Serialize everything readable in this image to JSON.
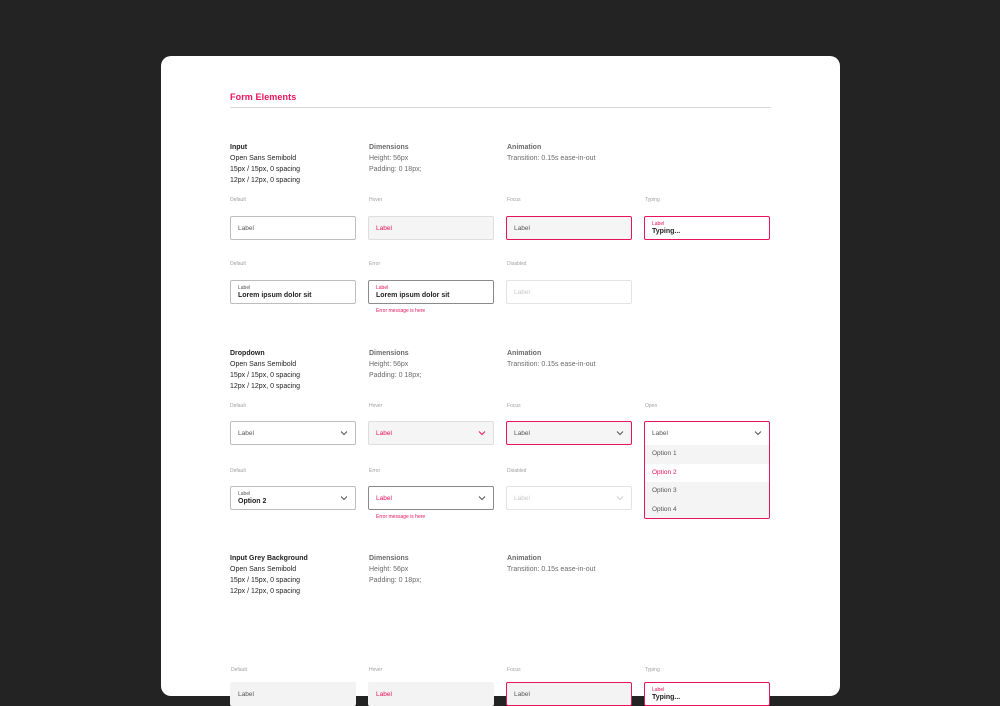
{
  "page_title": "Form Elements",
  "colors": {
    "accent": "#e8135b",
    "background": "#232323",
    "sheet": "#ffffff"
  },
  "sections": {
    "input": {
      "spec": {
        "name": "Input",
        "font": "Open Sans Semibold",
        "size_1": "15px / 15px, 0 spacing",
        "size_2": "12px / 12px, 0 spacing",
        "dim_title": "Dimensions",
        "height": "Height: 56px",
        "padding": "Padding: 0 18px;",
        "anim_title": "Animation",
        "transition": "Transition: 0.15s ease-in-out"
      },
      "row1": {
        "default": {
          "state": "Default",
          "placeholder": "Label"
        },
        "hover": {
          "state": "Hover",
          "placeholder": "Label"
        },
        "focus": {
          "state": "Focus",
          "placeholder": "Label"
        },
        "typing": {
          "state": "Typing",
          "label": "Label",
          "value": "Typing..."
        }
      },
      "row2": {
        "default": {
          "state": "Default",
          "label": "Label",
          "value": "Lorem ipsum dolor sit"
        },
        "error": {
          "state": "Error",
          "label": "Label",
          "value": "Lorem ipsum dolor sit",
          "message": "Error message is here"
        },
        "disabled": {
          "state": "Disabled",
          "placeholder": "Label"
        }
      }
    },
    "dropdown": {
      "spec": {
        "name": "Dropdown",
        "font": "Open Sans Semibold",
        "size_1": "15px / 15px, 0 spacing",
        "size_2": "12px / 12px, 0 spacing",
        "dim_title": "Dimensions",
        "height": "Height: 56px",
        "padding": "Padding: 0 18px;",
        "anim_title": "Animation",
        "transition": "Transition: 0.15s ease-in-out"
      },
      "row1": {
        "default": {
          "state": "Default",
          "placeholder": "Label"
        },
        "hover": {
          "state": "Hover",
          "placeholder": "Label"
        },
        "focus": {
          "state": "Focus",
          "placeholder": "Label"
        },
        "open": {
          "state": "Open",
          "placeholder": "Label",
          "options": [
            "Option 1",
            "Option 2",
            "Option 3",
            "Option 4"
          ],
          "selected_index": 1
        }
      },
      "row2": {
        "default": {
          "state": "Default",
          "label": "Label",
          "value": "Option 2"
        },
        "error": {
          "state": "Error",
          "placeholder": "Label",
          "message": "Error message is here"
        },
        "disabled": {
          "state": "Disabled",
          "placeholder": "Label"
        }
      }
    },
    "grey": {
      "spec": {
        "name": "Input Grey Background",
        "font": "Open Sans Semibold",
        "size_1": "15px / 15px, 0 spacing",
        "size_2": "12px / 12px, 0 spacing",
        "dim_title": "Dimensions",
        "height": "Height: 56px",
        "padding": "Padding: 0 18px;",
        "anim_title": "Animation",
        "transition": "Transition: 0.15s ease-in-out"
      },
      "row1": {
        "default": {
          "state": "Default",
          "placeholder": "Label"
        },
        "hover": {
          "state": "Hover",
          "placeholder": "Label"
        },
        "focus": {
          "state": "Focus",
          "placeholder": "Label"
        },
        "typing": {
          "state": "Typing",
          "label": "Label",
          "value": "Typing..."
        }
      }
    }
  }
}
